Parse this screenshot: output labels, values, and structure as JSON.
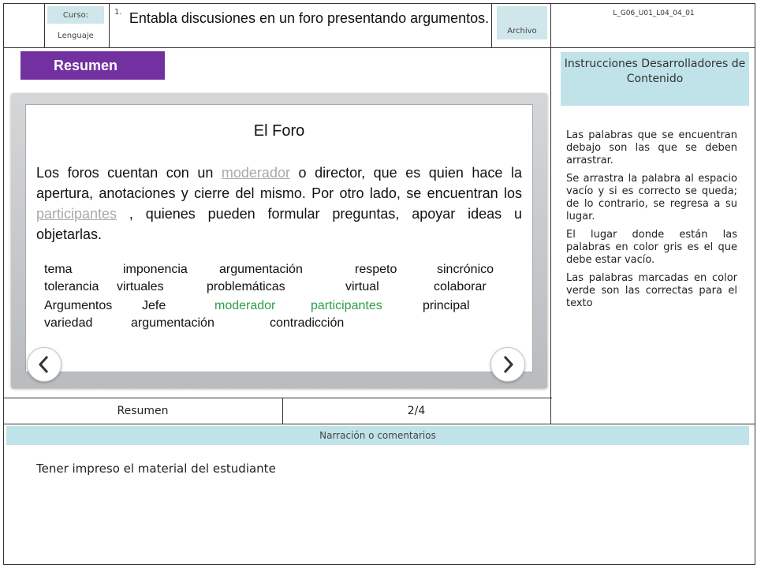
{
  "header": {
    "curso_label": "Curso:",
    "curso_value": "Lenguaje",
    "number": "1.",
    "title": "Entabla discusiones en un foro presentando argumentos.",
    "archivo_label": "Archivo",
    "code": "L_G06_U01_L04_04_01"
  },
  "slide": {
    "section_tag": "Resumen",
    "title": "El Foro",
    "paragraph": {
      "part1": "Los foros cuentan con un ",
      "gap1": "moderador",
      "part2": " o director, que es quien hace la apertura, anotaciones y cierre del mismo. Por otro lado, se encuentran los ",
      "gap2": "participantes",
      "part3": " ,  quienes pueden formular preguntas, apoyar ideas u objetarlas."
    },
    "word_bank": [
      [
        "tema",
        "imponencia",
        "argumentación",
        "respeto",
        "sincrónico"
      ],
      [
        "tolerancia",
        "virtuales",
        "problemáticas",
        "virtual",
        "colaborar"
      ],
      [
        "Argumentos",
        "Jefe",
        "moderador",
        "participantes",
        "principal"
      ],
      [
        "variedad",
        "argumentación",
        "contradicción"
      ]
    ],
    "correct_words": [
      "moderador",
      "participantes"
    ],
    "prev_icon": "chevron-left-icon",
    "next_icon": "chevron-right-icon"
  },
  "instructions": {
    "title": "Instrucciones Desarrolladores de Contenido",
    "paragraphs": [
      "Las palabras que se encuentran debajo son las que se deben arrastrar.",
      "Se arrastra la palabra al espacio vacío  y si es correcto se queda; de lo contrario, se regresa a su lugar.",
      "El lugar donde están las palabras en color gris es el que debe estar vacío.",
      "Las palabras marcadas en color verde son las correctas para el texto"
    ]
  },
  "footer": {
    "section": "Resumen",
    "page": "2/4",
    "narration_label": "Narración o comentarios",
    "narration_text": "Tener impreso el material del estudiante"
  },
  "colors": {
    "tag_purple": "#7230a0",
    "light_blue": "#bfe3e8",
    "correct_green": "#2e9e4c",
    "gap_gray": "#a9a9a9"
  }
}
